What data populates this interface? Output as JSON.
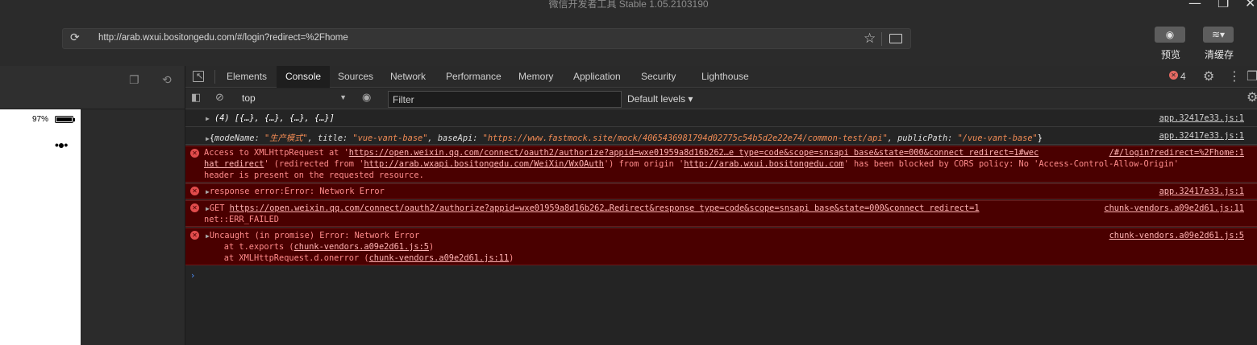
{
  "window": {
    "title": "微信开发者工具 Stable 1.05.2103190",
    "minimize_glyph": "—",
    "maximize_glyph": "❐",
    "close_glyph": "✕"
  },
  "toolbar": {
    "url": "http://arab.wxui.bositongedu.com/#/login?redirect=%2Fhome",
    "preview_label": "预览",
    "clear_cache_label": "清缓存",
    "icons": [
      "reload-icon",
      "star-icon",
      "folder-icon",
      "eye-icon",
      "layers-icon"
    ]
  },
  "simulator": {
    "battery_text": "97%",
    "menu_dots": "•●•"
  },
  "devtools": {
    "tabs": [
      "Elements",
      "Console",
      "Sources",
      "Network",
      "Performance",
      "Memory",
      "Application",
      "Security",
      "Lighthouse"
    ],
    "active_tab": "Console",
    "error_count": "4",
    "context": "top",
    "filter_placeholder": "Filter",
    "levels_label": "Default levels ▾"
  },
  "console": {
    "rows": [
      {
        "type": "log",
        "text": "(4) [{…}, {…}, {…}, {…}]",
        "source": "app.32417e33.js:1"
      },
      {
        "type": "log",
        "object": {
          "open": "{",
          "k1": "modeName: ",
          "v1": "\"生产模式\"",
          "k2": ", title: ",
          "v2": "\"vue-vant-base\"",
          "k3": ", baseApi: ",
          "v3": "\"https://www.fastmock.site/mock/4065436981794d02775c54b5d2e22e74/common-test/api\"",
          "k4": ", publicPath: ",
          "v4": "\"/vue-vant-base\"",
          "close": "}"
        },
        "source": "app.32417e33.js:1"
      },
      {
        "type": "error",
        "line1_a": "Access to XMLHttpRequest at '",
        "line1_link": "https://open.weixin.qq.com/connect/oauth2/authorize?appid=wxe01959a8d16b262…e type=code&scope=snsapi base&state=000&connect redirect=1#wec",
        "line2_link_a": "hat redirect",
        "line2_b": "' (redirected from '",
        "line2_link_b": "http://arab.wxapi.bositongedu.com/WeiXin/WxOAuth",
        "line2_c": "') from origin '",
        "line2_link_c": "http://arab.wxui.bositongedu.com",
        "line2_d": "' has been blocked by CORS policy: No 'Access-Control-Allow-Origin'",
        "line3": "header is present on the requested resource.",
        "source": "/#/login?redirect=%2Fhome:1"
      },
      {
        "type": "error",
        "text": "response error:Error: Network Error",
        "source": "app.32417e33.js:1"
      },
      {
        "type": "error",
        "method": "GET ",
        "link": "https://open.weixin.qq.com/connect/oauth2/authorize?appid=wxe01959a8d16b262…Redirect&response type=code&scope=snsapi base&state=000&connect redirect=1",
        "line2": "net::ERR_FAILED",
        "source": "chunk-vendors.a09e2d61.js:11"
      },
      {
        "type": "error",
        "text": "Uncaught (in promise) Error: Network Error",
        "stack1_a": "    at t.exports (",
        "stack1_link": "chunk-vendors.a09e2d61.js:5",
        "stack1_b": ")",
        "stack2_a": "    at XMLHttpRequest.d.onerror (",
        "stack2_link": "chunk-vendors.a09e2d61.js:11",
        "stack2_b": ")",
        "source": "chunk-vendors.a09e2d61.js:5"
      }
    ],
    "prompt": "›"
  },
  "colors": {
    "error_bg": "#4a0000",
    "error_text": "#ff8b8b",
    "string": "#f28b54",
    "prompt": "#4e8ef7"
  }
}
